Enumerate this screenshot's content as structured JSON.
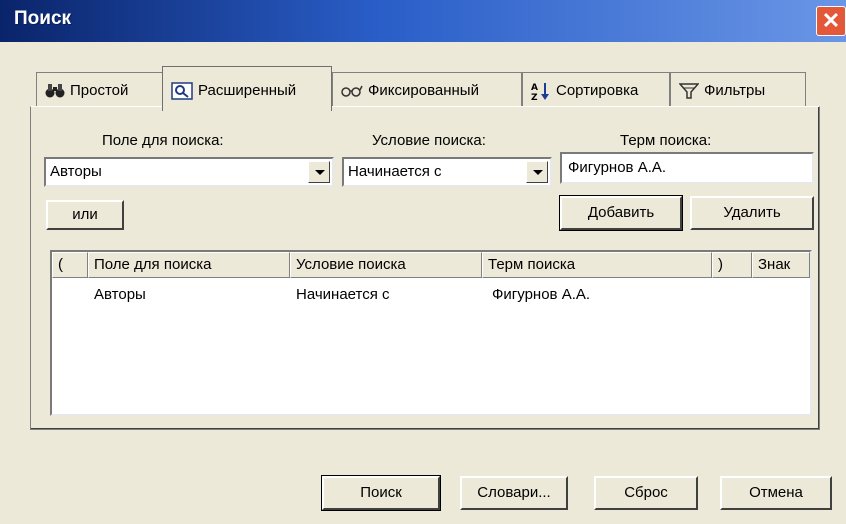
{
  "window": {
    "title": "Поиск",
    "close_label": "✕"
  },
  "tabs": [
    {
      "label": "Простой",
      "icon": "binoculars-icon",
      "active": false
    },
    {
      "label": "Расширенный",
      "icon": "magnifier-doc-icon",
      "active": true
    },
    {
      "label": "Фиксированный",
      "icon": "glasses-icon",
      "active": false
    },
    {
      "label": "Сортировка",
      "icon": "sort-az-icon",
      "active": false
    },
    {
      "label": "Фильтры",
      "icon": "filter-icon",
      "active": false
    }
  ],
  "criteria": {
    "field_label": "Поле для поиска:",
    "condition_label": "Условие поиска:",
    "term_label": "Терм поиска:",
    "field_value": "Авторы",
    "condition_value": "Начинается с",
    "term_value": "Фигурнов А.А."
  },
  "buttons": {
    "or": "или",
    "add": "Добавить",
    "delete": "Удалить",
    "search": "Поиск",
    "dictionaries": "Словари...",
    "reset": "Сброс",
    "cancel": "Отмена"
  },
  "grid": {
    "columns": [
      "(",
      "Поле для поиска",
      "Условие поиска",
      "Терм поиска",
      ")",
      "Знак"
    ],
    "rows": [
      {
        "open": "",
        "field": "Авторы",
        "condition": "Начинается с",
        "term": "Фигурнов А.А.",
        "close": "",
        "sign": ""
      }
    ]
  }
}
